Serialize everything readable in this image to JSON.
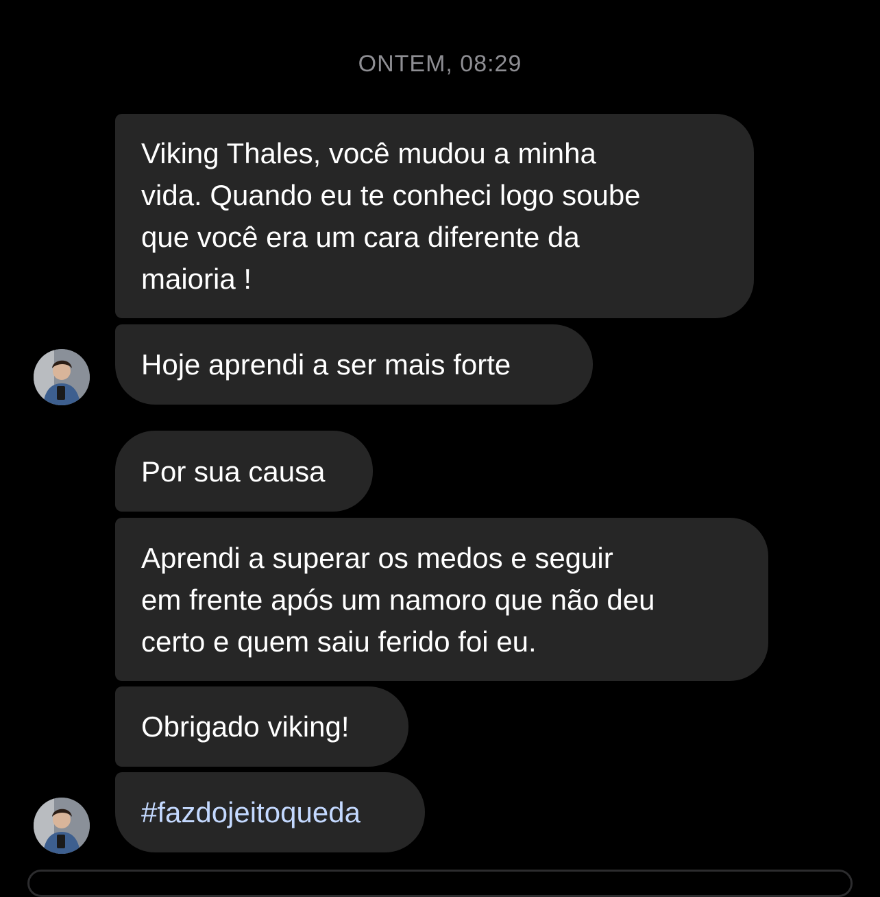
{
  "thread": {
    "timestamp": "ONTEM, 08:29"
  },
  "messages": [
    {
      "text": "Viking Thales, você mudou a minha\nvida. Quando eu te conheci logo soube\nque você era um cara diferente da\nmaioria !"
    },
    {
      "text": "Hoje aprendi a ser mais forte"
    },
    {
      "text": "Por sua causa"
    },
    {
      "text": "Aprendi a superar os medos e seguir\nem frente após um namoro que não deu\ncerto e quem saiu ferido foi eu."
    },
    {
      "text": "Obrigado viking!"
    },
    {
      "text": "#fazdojeitoqueda"
    }
  ],
  "colors": {
    "background": "#000000",
    "bubble": "#262626",
    "timestamp": "#8e8e93",
    "hashtag": "#c4d9ff"
  },
  "icons": {
    "avatar": "user-avatar-photo"
  }
}
